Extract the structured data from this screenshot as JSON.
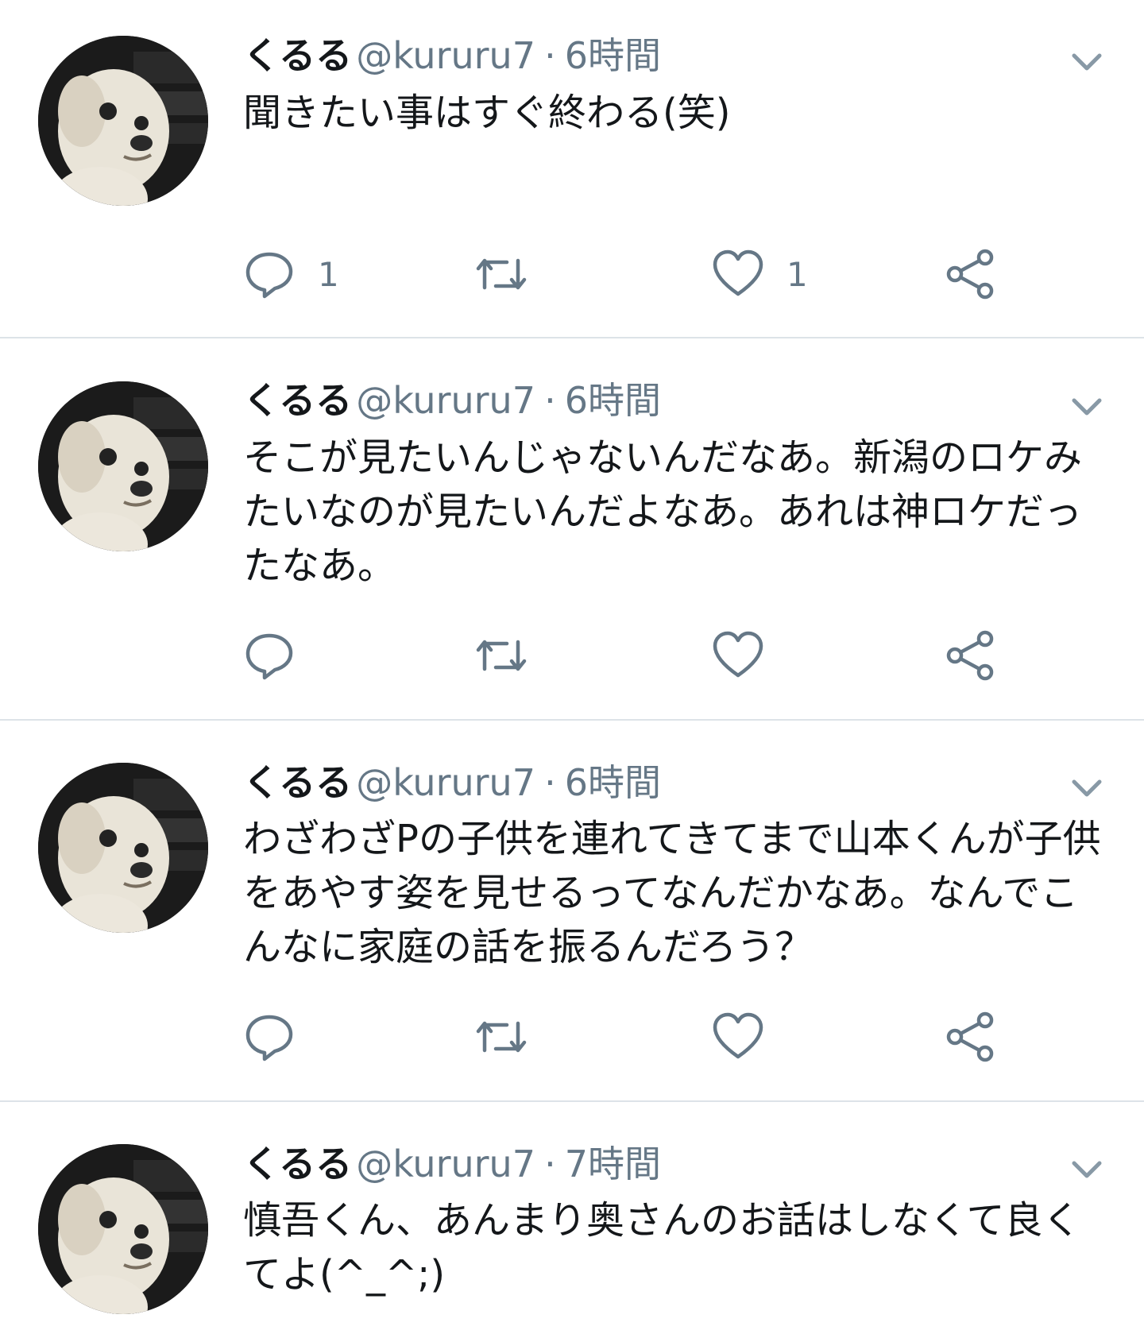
{
  "tweets": [
    {
      "name": "くるる",
      "handle": "@kururu7",
      "separator": "·",
      "time": "6時間",
      "text": "聞きたい事はすぐ終わる(笑)",
      "reply_count": "1",
      "retweet_count": "",
      "like_count": "1"
    },
    {
      "name": "くるる",
      "handle": "@kururu7",
      "separator": "·",
      "time": "6時間",
      "text": "そこが見たいんじゃないんだなあ。新潟のロケみたいなのが見たいんだよなあ。あれは神ロケだったなあ。",
      "reply_count": "",
      "retweet_count": "",
      "like_count": ""
    },
    {
      "name": "くるる",
      "handle": "@kururu7",
      "separator": "·",
      "time": "6時間",
      "text": "わざわざPの子供を連れてきてまで山本くんが子供をあやす姿を見せるってなんだかなあ。なんでこんなに家庭の話を振るんだろう？",
      "reply_count": "",
      "retweet_count": "",
      "like_count": ""
    },
    {
      "name": "くるる",
      "handle": "@kururu7",
      "separator": "·",
      "time": "7時間",
      "text": "慎吾くん、あんまり奥さんのお話はしなくて良くてよ(^_^;)",
      "reply_count": "",
      "retweet_count": "",
      "like_count": ""
    }
  ],
  "icons": {
    "reply": "reply-icon",
    "retweet": "retweet-icon",
    "like": "heart-icon",
    "share": "share-icon",
    "menu": "chevron-down-icon",
    "avatar": "dog-avatar"
  },
  "colors": {
    "text": "#14171a",
    "secondary": "#657786",
    "divider": "#dde3e8"
  }
}
